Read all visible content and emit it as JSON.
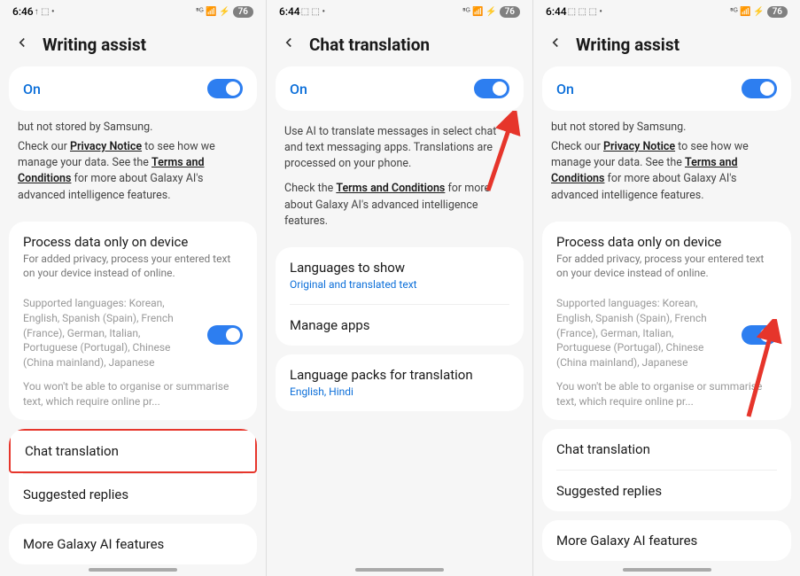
{
  "p1": {
    "status": {
      "time": "6:46",
      "icons": "↑ ⬚ •",
      "right_icons": "⁵ᴳ 📶 ⚡",
      "battery": "76"
    },
    "header": {
      "title": "Writing assist"
    },
    "on": {
      "label": "On"
    },
    "clipped": "but not stored by Samsung.",
    "desc1_pre": "Check our ",
    "privacy": "Privacy Notice",
    "desc1_mid": " to see how we manage your data. See the ",
    "terms": "Terms and Conditions",
    "desc1_post": " for more about Galaxy AI's advanced intelligence features.",
    "process": {
      "title": "Process data only on device",
      "sub": "For added privacy, process your entered text on your device instead of online."
    },
    "supported": "Supported languages: Korean, English, Spanish (Spain), French (France), German, Italian, Portuguese (Portugal), Chinese (China mainland), Japanese",
    "warn": "You won't be able to organise or summarise text, which require online pr...",
    "chat": "Chat translation",
    "suggested": "Suggested replies",
    "more": "More Galaxy AI features"
  },
  "p2": {
    "status": {
      "time": "6:44",
      "icons": "⬚ ⬚ •",
      "right_icons": "⁵ᴳ 📶 ⚡",
      "battery": "76"
    },
    "header": {
      "title": "Chat translation"
    },
    "on": {
      "label": "On"
    },
    "desc_body": "Use AI to translate messages in select chat and text messaging apps. Translations are processed on your phone.",
    "desc2_pre": "Check the ",
    "terms": "Terms and Conditions",
    "desc2_post": " for more about Galaxy AI's advanced intelligence features.",
    "lang_show": {
      "title": "Languages to show",
      "sub": "Original and translated text"
    },
    "manage": "Manage apps",
    "packs": {
      "title": "Language packs for translation",
      "sub": "English, Hindi"
    }
  },
  "p3": {
    "status": {
      "time": "6:44",
      "icons": "⬚ ⬚ ⬚ •",
      "right_icons": "⁵ᴳ 📶 ⚡",
      "battery": "76"
    },
    "header": {
      "title": "Writing assist"
    },
    "on": {
      "label": "On"
    },
    "clipped": "but not stored by Samsung.",
    "desc1_pre": "Check our ",
    "privacy": "Privacy Notice",
    "desc1_mid": " to see how we manage your data. See the ",
    "terms": "Terms and Conditions",
    "desc1_post": " for more about Galaxy AI's advanced intelligence features.",
    "process": {
      "title": "Process data only on device",
      "sub": "For added privacy, process your entered text on your device instead of online."
    },
    "supported": "Supported languages: Korean, English, Spanish (Spain), French (France), German, Italian, Portuguese (Portugal), Chinese (China mainland), Japanese",
    "warn": "You won't be able to organise or summarise text, which require online pr...",
    "chat": "Chat translation",
    "suggested": "Suggested replies",
    "more": "More Galaxy AI features"
  }
}
